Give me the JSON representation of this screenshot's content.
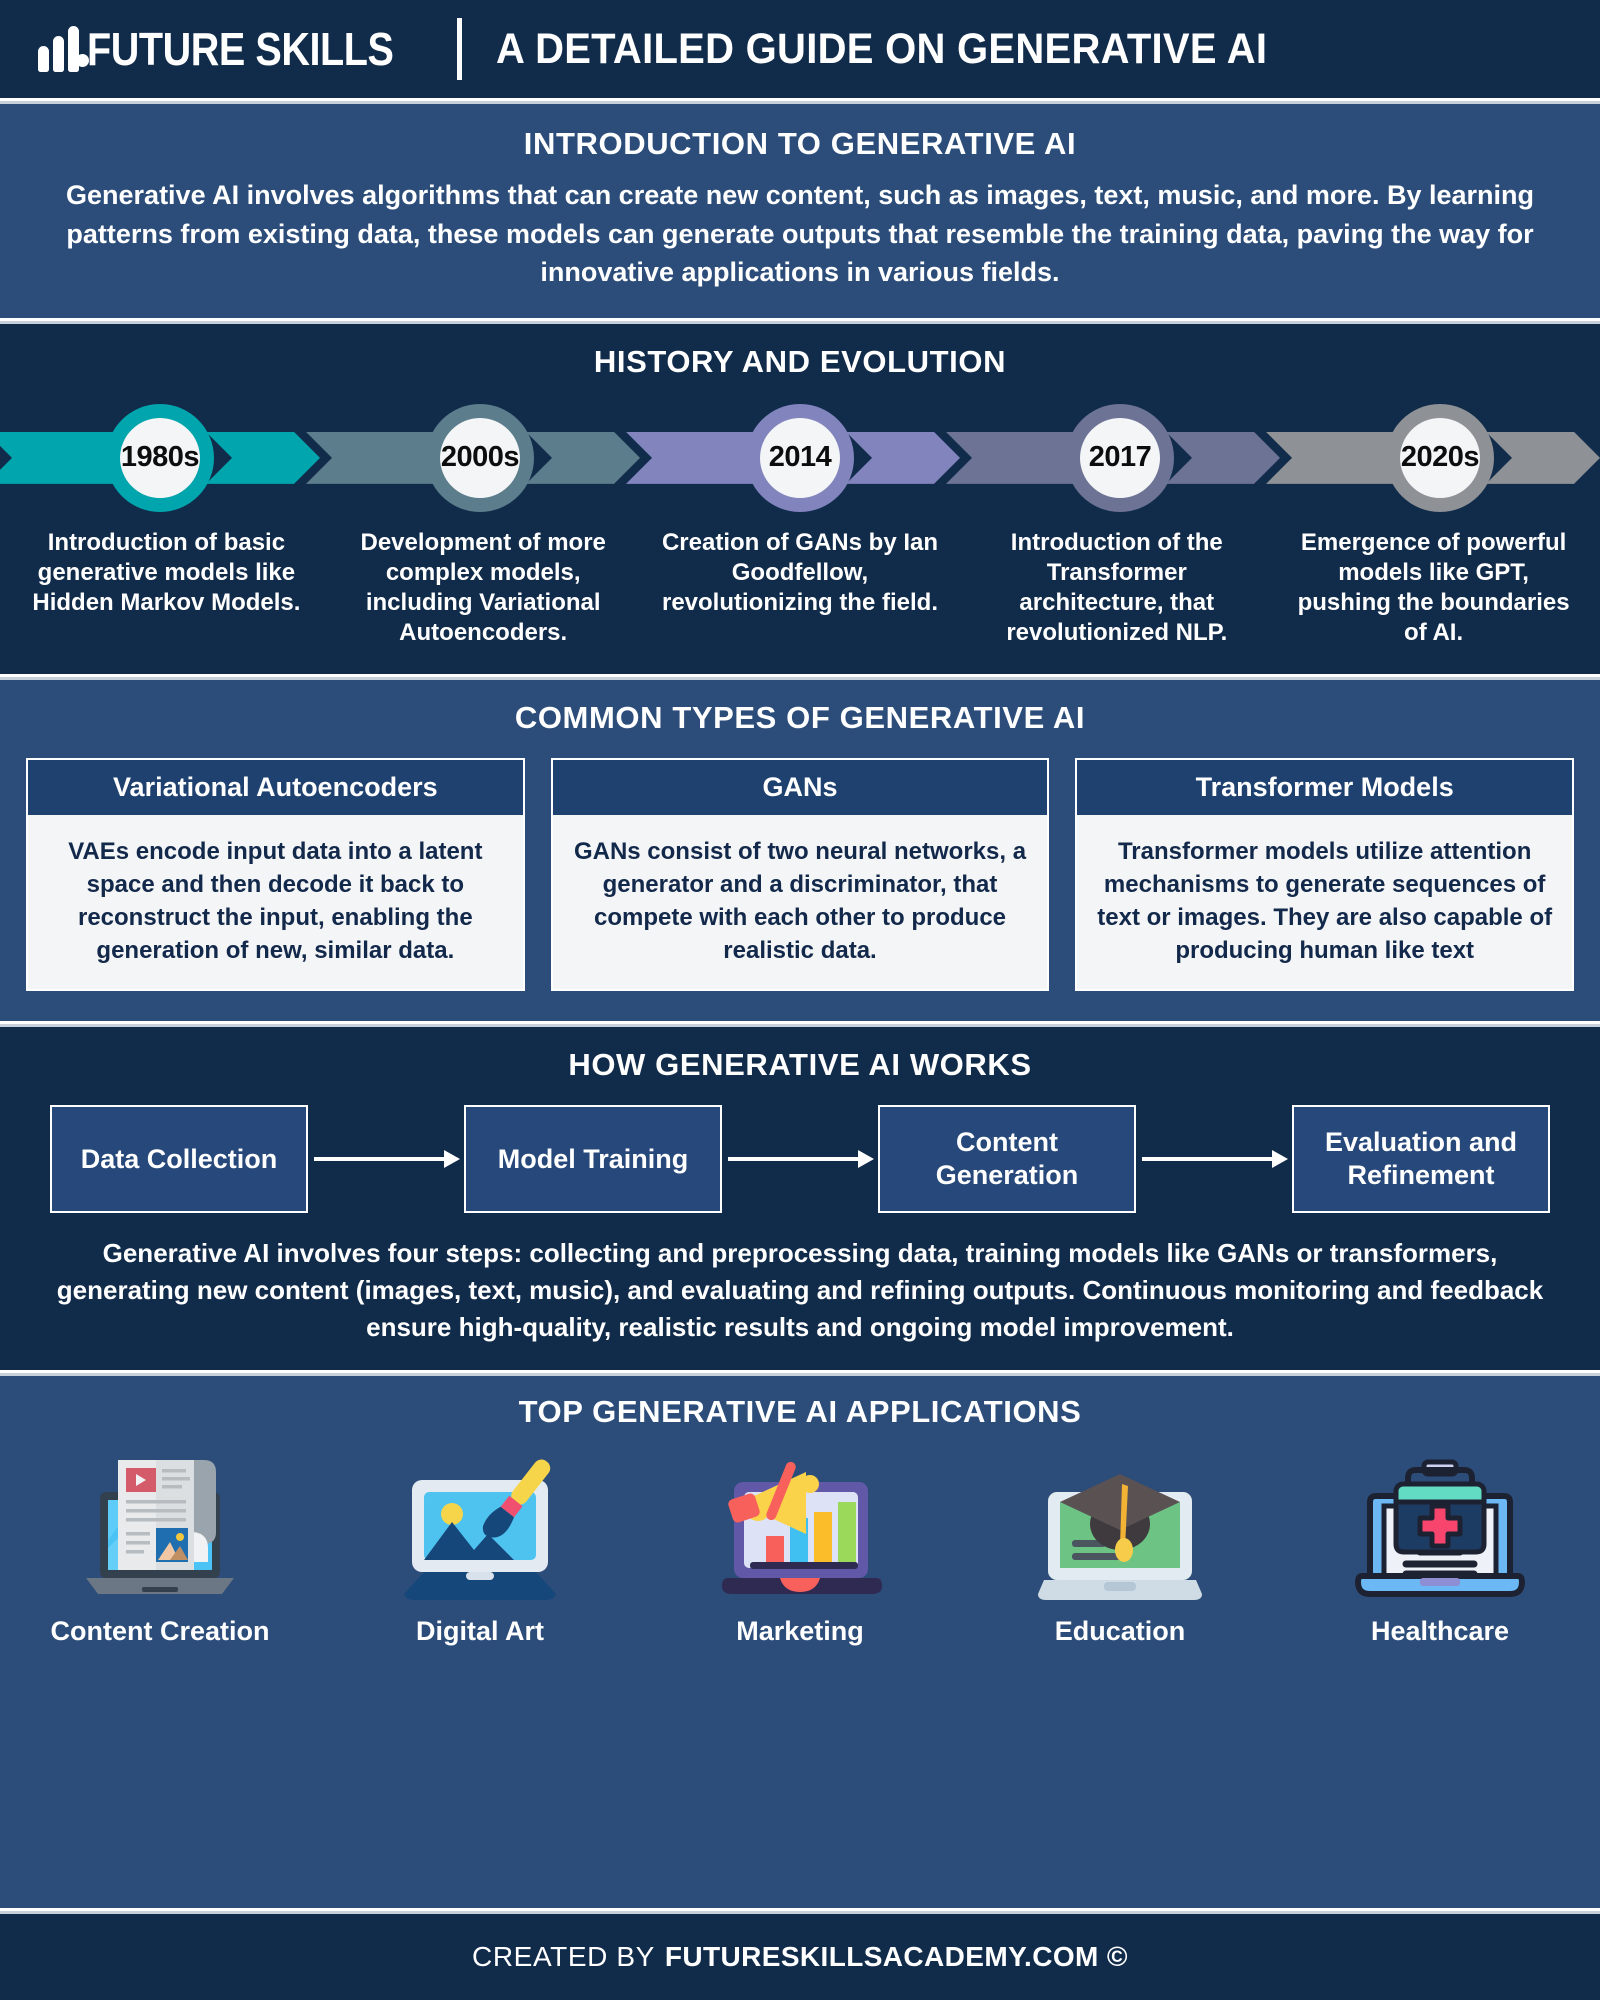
{
  "header": {
    "logo_text": "FUTURE SKILLS",
    "title": "A DETAILED GUIDE ON GENERATIVE AI"
  },
  "intro": {
    "heading": "INTRODUCTION TO GENERATIVE AI",
    "body": "Generative AI involves algorithms that can create new content, such as images, text, music, and more. By learning patterns from existing data, these models can generate outputs that resemble the training data, paving the way for innovative applications in various fields."
  },
  "history": {
    "heading": "HISTORY AND EVOLUTION",
    "milestones": [
      {
        "year": "1980s",
        "text": "Introduction of basic generative models like Hidden Markov Models.",
        "color": "#00a5ad"
      },
      {
        "year": "2000s",
        "text": "Development of more complex models, including Variational Autoencoders.",
        "color": "#5c7d8c"
      },
      {
        "year": "2014",
        "text": "Creation of GANs by Ian Goodfellow, revolutionizing the field.",
        "color": "#8184bd"
      },
      {
        "year": "2017",
        "text": "Introduction of the Transformer architecture, that revolutionized NLP.",
        "color": "#6d7395"
      },
      {
        "year": "2020s",
        "text": "Emergence of powerful models like GPT, pushing the boundaries of AI.",
        "color": "#8e9195"
      }
    ]
  },
  "types": {
    "heading": "COMMON TYPES OF GENERATIVE AI",
    "cards": [
      {
        "title": "Variational Autoencoders",
        "body": "VAEs encode input data into a latent space and then decode it back to reconstruct the input, enabling the generation of new, similar data."
      },
      {
        "title": "GANs",
        "body": "GANs consist of two neural networks, a generator and a discriminator, that compete with each other to produce realistic data."
      },
      {
        "title": "Transformer Models",
        "body": "Transformer models utilize attention mechanisms to generate sequences of text or images. They are also capable of producing human like text"
      }
    ]
  },
  "works": {
    "heading": "HOW GENERATIVE AI WORKS",
    "steps": [
      "Data Collection",
      "Model Training",
      "Content Generation",
      "Evaluation and Refinement"
    ],
    "body": "Generative AI involves four steps: collecting and preprocessing data, training models like GANs or transformers, generating new content (images, text, music), and evaluating and refining outputs. Continuous monitoring and feedback ensure high-quality, realistic results and ongoing model improvement."
  },
  "apps": {
    "heading": "TOP GENERATIVE AI APPLICATIONS",
    "items": [
      {
        "label": "Content Creation",
        "icon": "laptop-document-icon"
      },
      {
        "label": "Digital Art",
        "icon": "laptop-paintbrush-icon"
      },
      {
        "label": "Marketing",
        "icon": "laptop-megaphone-chart-icon"
      },
      {
        "label": "Education",
        "icon": "laptop-graduation-cap-icon"
      },
      {
        "label": "Healthcare",
        "icon": "laptop-medical-kit-icon"
      }
    ]
  },
  "footer": {
    "prefix": "CREATED BY",
    "brand": "FUTURESKILLSACADEMY.COM ©"
  },
  "colors": {
    "dark_navy": "#112b4a",
    "mid_navy": "#2c4d7a",
    "card_navy": "#1f4170",
    "teal": "#00a5ad",
    "card_bg": "#f4f5f6"
  }
}
